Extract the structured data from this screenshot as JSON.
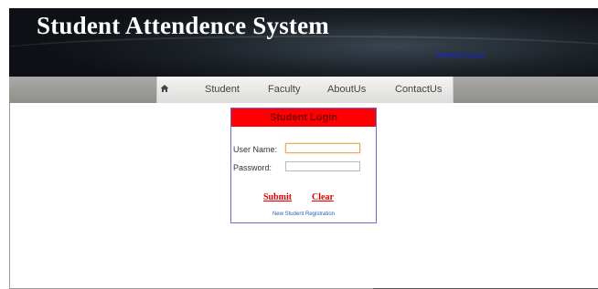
{
  "header": {
    "title": "Student Attendence System",
    "welcome_text": "Welcome Guest"
  },
  "nav": {
    "items": [
      {
        "label": "Student"
      },
      {
        "label": "Faculty"
      },
      {
        "label": "AboutUs"
      },
      {
        "label": "ContactUs"
      }
    ]
  },
  "login": {
    "title": "Student Login",
    "username_label": "User Name:",
    "username_value": "",
    "password_label": "Password:",
    "password_value": "",
    "submit_label": "Submit",
    "clear_label": "Clear",
    "register_link": "New Student Registration"
  },
  "colors": {
    "header_bg": "#1c2228",
    "login_title_bg": "#ff0000",
    "button_text": "#e00000",
    "link": "#2a5db0"
  },
  "icons": {
    "home": "home-icon"
  }
}
